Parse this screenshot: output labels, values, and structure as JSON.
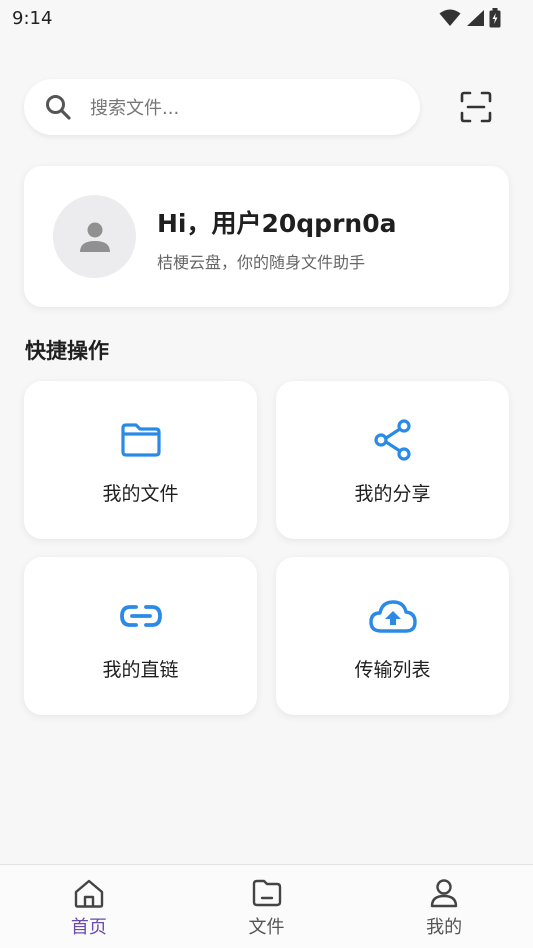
{
  "status_bar": {
    "time": "9:14",
    "icons": [
      "wifi-icon",
      "signal-icon",
      "battery-icon"
    ]
  },
  "search": {
    "placeholder": "搜索文件...",
    "icon": "search-icon",
    "scan_icon": "scan-icon"
  },
  "profile": {
    "greeting": "Hi，用户20qprn0a",
    "tagline": "桔梗云盘，你的随身文件助手",
    "avatar_icon": "person-icon"
  },
  "quick_actions": {
    "title": "快捷操作",
    "items": [
      {
        "label": "我的文件",
        "icon": "folder-icon"
      },
      {
        "label": "我的分享",
        "icon": "share-icon"
      },
      {
        "label": "我的直链",
        "icon": "link-icon"
      },
      {
        "label": "传输列表",
        "icon": "cloud-upload-icon"
      }
    ]
  },
  "bottom_nav": {
    "items": [
      {
        "label": "首页",
        "icon": "home-icon",
        "active": true
      },
      {
        "label": "文件",
        "icon": "file-folder-icon",
        "active": false
      },
      {
        "label": "我的",
        "icon": "user-icon",
        "active": false
      }
    ]
  },
  "colors": {
    "accent": "#2a8ae6",
    "nav_active": "#6a4bb0",
    "background": "#f7f7f8"
  }
}
